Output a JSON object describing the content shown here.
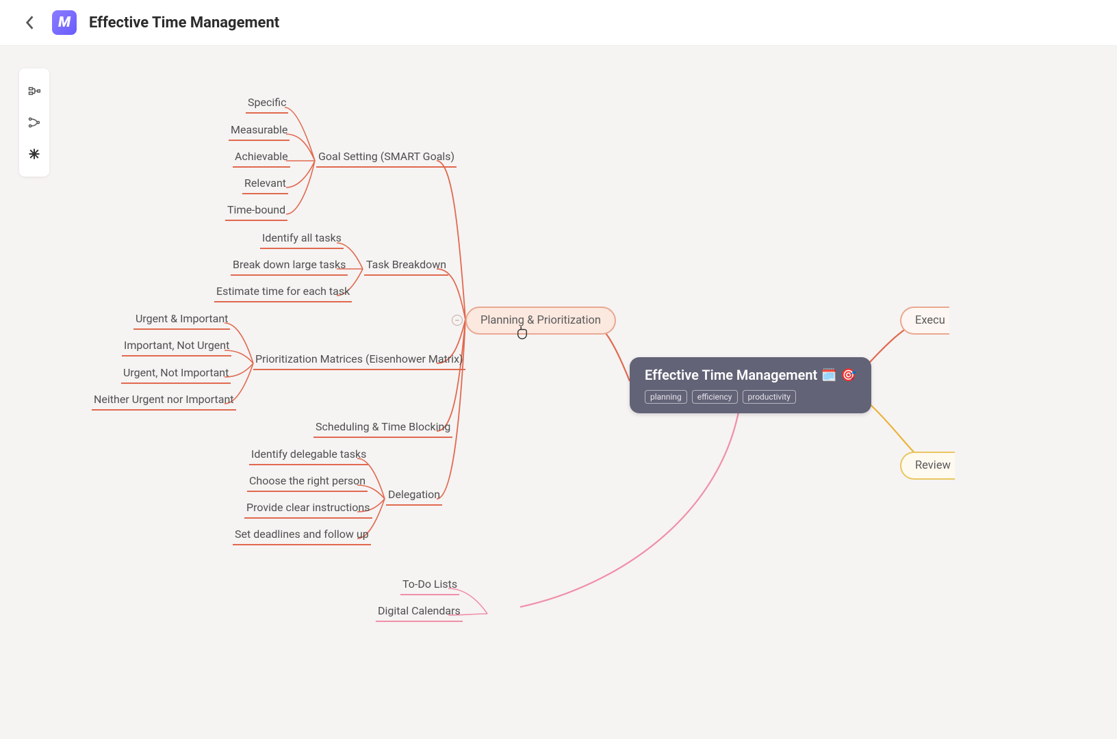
{
  "header": {
    "title": "Effective Time Management"
  },
  "root": {
    "title": "Effective Time Management",
    "emoji1": "🗓️",
    "emoji2": "🎯",
    "tags": [
      "planning",
      "efficiency",
      "productivity"
    ]
  },
  "branches": {
    "planning": {
      "label": "Planning & Prioritization",
      "children": {
        "goal_setting": {
          "label": "Goal Setting (SMART Goals)",
          "leaves": [
            "Specific",
            "Measurable",
            "Achievable",
            "Relevant",
            "Time-bound"
          ]
        },
        "task_breakdown": {
          "label": "Task Breakdown",
          "leaves": [
            "Identify all tasks",
            "Break down large tasks",
            "Estimate time for each task"
          ]
        },
        "matrices": {
          "label": "Prioritization Matrices (Eisenhower Matrix)",
          "leaves": [
            "Urgent & Important",
            "Important, Not Urgent",
            "Urgent, Not Important",
            "Neither Urgent nor Important"
          ]
        },
        "scheduling": {
          "label": "Scheduling & Time Blocking"
        },
        "delegation": {
          "label": "Delegation",
          "leaves": [
            "Identify delegable tasks",
            "Choose the right person",
            "Provide clear instructions",
            "Set deadlines and follow up"
          ]
        }
      }
    },
    "execution": {
      "label": "Execu"
    },
    "review": {
      "label": "Review"
    },
    "tools": {
      "leaves": [
        "To-Do Lists",
        "Digital Calendars"
      ]
    }
  },
  "collapse_symbol": "–"
}
